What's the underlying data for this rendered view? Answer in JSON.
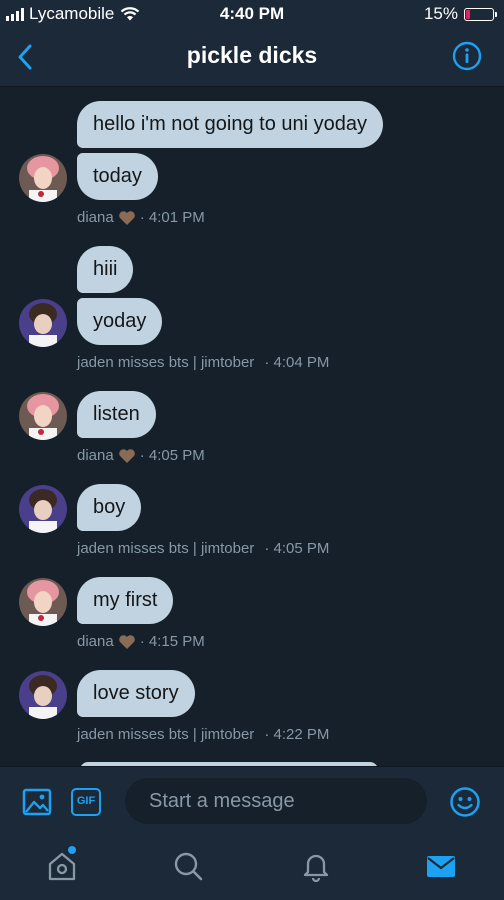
{
  "status_bar": {
    "carrier": "Lycamobile",
    "time": "4:40 PM",
    "battery": "15%",
    "battery_level": 0.15,
    "icons": [
      "signal-bars-icon",
      "wifi-icon",
      "battery-icon"
    ]
  },
  "header": {
    "title": "pickle dicks",
    "back_icon": "chevron-left-icon",
    "info_icon": "info-icon"
  },
  "messages": {
    "m1": {
      "text": "hello i'm not going to uni yoday"
    },
    "m2": {
      "text": "today"
    },
    "meta1": {
      "sender": "diana",
      "time": "· 4:01 PM"
    },
    "m3": {
      "text": "hiii"
    },
    "m4": {
      "text": "yoday"
    },
    "meta2": {
      "sender": "jaden misses bts | jimtober",
      "time": "· 4:04 PM"
    },
    "m5": {
      "text": "listen"
    },
    "meta3": {
      "sender": "diana",
      "time": "· 4:05 PM"
    },
    "m6": {
      "text": "boy"
    },
    "meta4": {
      "sender": "jaden misses bts | jimtober",
      "time": "· 4:05 PM"
    },
    "m7": {
      "text": "my first"
    },
    "meta5": {
      "sender": "diana",
      "time": "· 4:15 PM"
    },
    "m8": {
      "text": "love story"
    },
    "meta6": {
      "sender": "jaden misses bts | jimtober",
      "time": "· 4:22 PM"
    }
  },
  "composer": {
    "placeholder": "Start a message",
    "gif_label": "GIF",
    "icons": [
      "image-icon",
      "gif-icon",
      "emoji-icon"
    ]
  },
  "tabbar": {
    "icons": [
      "home-icon",
      "search-icon",
      "bell-icon",
      "mail-icon"
    ]
  },
  "colors": {
    "background": "#15202b",
    "bar": "#1c2938",
    "bubble": "#c1d3e0",
    "accent": "#1da1f2",
    "muted": "#8899a6",
    "battery_low": "#e0245e"
  }
}
